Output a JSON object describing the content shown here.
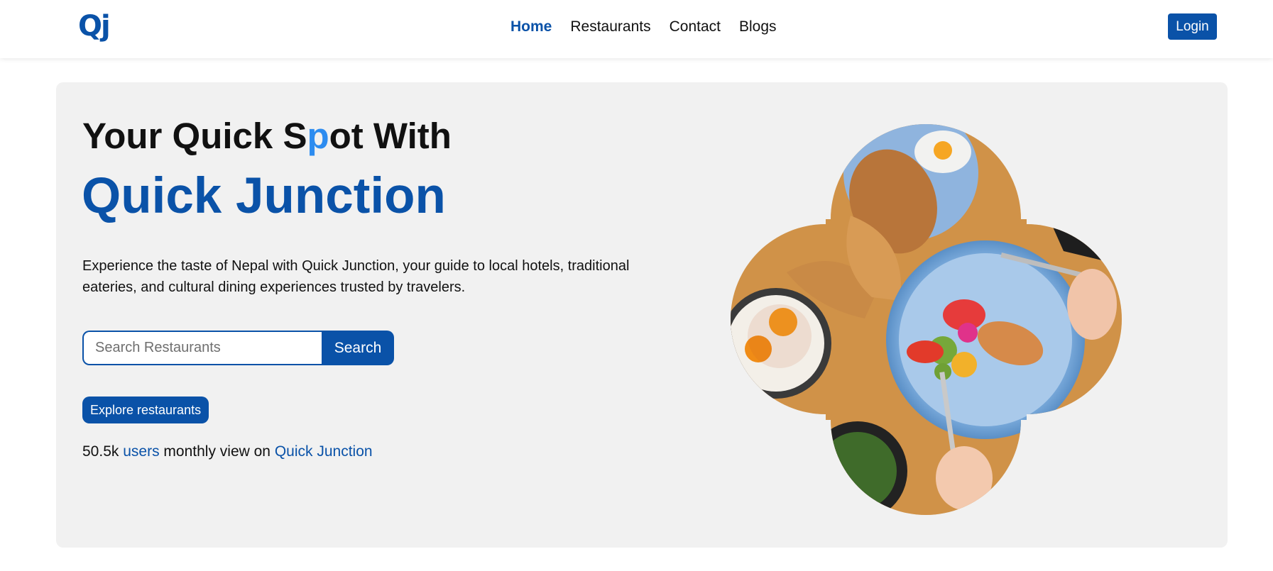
{
  "brand": {
    "logo_text": "Qj",
    "accent_color": "#0a52a8",
    "cursor_color": "#2d8cf0"
  },
  "nav": {
    "items": [
      {
        "label": "Home",
        "active": true
      },
      {
        "label": "Restaurants",
        "active": false
      },
      {
        "label": "Contact",
        "active": false
      },
      {
        "label": "Blogs",
        "active": false
      }
    ],
    "login_label": "Login"
  },
  "hero": {
    "line1_before": "Your Quick S",
    "line1_cursor": "p",
    "line1_after": "ot With",
    "title": "Quick Junction",
    "description": "Experience the taste of Nepal with Quick Junction, your guide to local hotels, traditional eateries, and cultural dining experiences trusted by travelers.",
    "search": {
      "placeholder": "Search Restaurants",
      "value": "",
      "button_label": "Search"
    },
    "explore_label": "Explore restaurants",
    "stats": {
      "count": "50.5k",
      "users_label": "users",
      "middle": "monthly view on",
      "site_label": "Quick Junction"
    },
    "image": {
      "icon": "food-photo",
      "description_hidden": true
    },
    "background": "#f1f1f1"
  }
}
